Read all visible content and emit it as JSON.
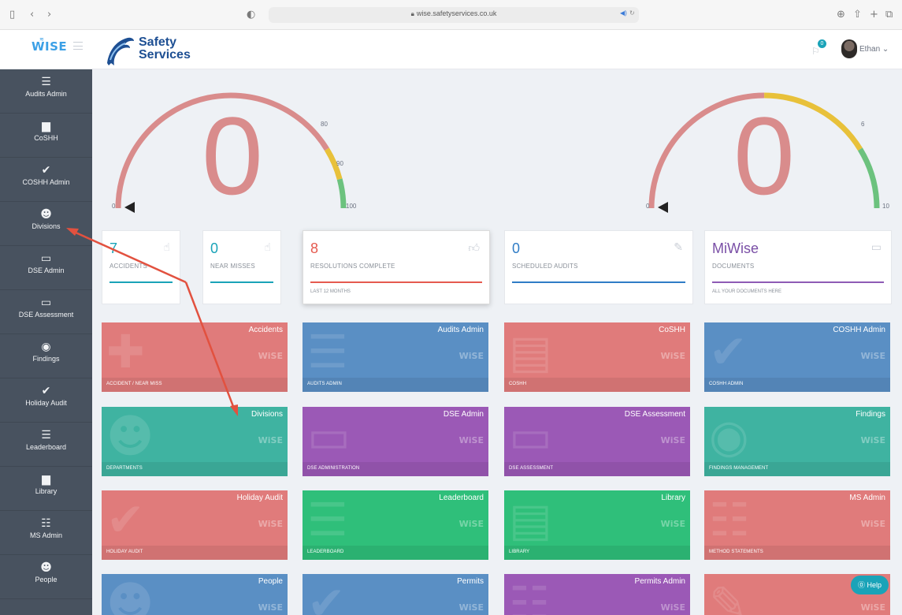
{
  "browser": {
    "url": "wise.safetyservices.co.uk",
    "icons": [
      "sidebar-icon",
      "back-icon",
      "forward-icon",
      "shield-icon",
      "download-icon",
      "share-icon",
      "new-tab-icon",
      "tabs-icon"
    ]
  },
  "header": {
    "app_logo": "WISE",
    "brand_line1": "Safety",
    "brand_line2": "Services",
    "notification_count": "0",
    "user_name": "Ethan ⌄"
  },
  "sidebar": {
    "items": [
      {
        "label": "Audits Admin",
        "icon": "list-icon"
      },
      {
        "label": "CoSHH",
        "icon": "book-icon"
      },
      {
        "label": "COSHH Admin",
        "icon": "check-icon"
      },
      {
        "label": "Divisions",
        "icon": "users-icon"
      },
      {
        "label": "DSE Admin",
        "icon": "monitor-icon"
      },
      {
        "label": "DSE Assessment",
        "icon": "monitor-icon"
      },
      {
        "label": "Findings",
        "icon": "eye-icon"
      },
      {
        "label": "Holiday Audit",
        "icon": "check-icon"
      },
      {
        "label": "Leaderboard",
        "icon": "list-icon"
      },
      {
        "label": "Library",
        "icon": "book-icon"
      },
      {
        "label": "MS Admin",
        "icon": "document-icon"
      },
      {
        "label": "People",
        "icon": "users-icon"
      }
    ]
  },
  "gauges": [
    {
      "value": "0",
      "value_number": 0,
      "ticks": [
        "0",
        "80",
        "90",
        "100"
      ],
      "segments": [
        {
          "color": "#d98c8c"
        },
        {
          "color": "#e8c13a"
        },
        {
          "color": "#6cc27e"
        }
      ]
    },
    {
      "value": "0",
      "value_number": 0,
      "ticks": [
        "0",
        "6",
        "10"
      ],
      "segments": [
        {
          "color": "#d98c8c"
        },
        {
          "color": "#e8c13a"
        },
        {
          "color": "#6cc27e"
        }
      ]
    }
  ],
  "stats": [
    {
      "value": "7",
      "label": "ACCIDENTS",
      "sub": "",
      "color": "#1aa3b8",
      "bar_color": "#1aa3b8",
      "icon": "hand-pointer-icon"
    },
    {
      "value": "0",
      "label": "NEAR MISSES",
      "sub": "",
      "color": "#1aa3b8",
      "bar_color": "#1aa3b8",
      "icon": "hand-pointer-icon"
    },
    {
      "value": "8",
      "label": "RESOLUTIONS COMPLETE",
      "sub": "LAST 12 MONTHS",
      "color": "#e55a4f",
      "bar_color": "#e55a4f",
      "icon": "thumbs-up-icon"
    },
    {
      "value": "0",
      "label": "SCHEDULED AUDITS",
      "sub": "",
      "color": "#2f7cc6",
      "bar_color": "#2f7cc6",
      "icon": "edit-icon"
    },
    {
      "value": "MiWise",
      "label": "DOCUMENTS",
      "sub": "ALL YOUR DOCUMENTS HERE",
      "color": "#7a4fa6",
      "bar_color": "#8e5bb5",
      "icon": "folder-icon"
    }
  ],
  "tiles": [
    {
      "title": "Accidents",
      "sub": "ACCIDENT / NEAR MISS",
      "color": "#e07b7b",
      "icon": "first-aid-icon"
    },
    {
      "title": "Audits Admin",
      "sub": "AUDITS ADMIN",
      "color": "#5a8fc4",
      "icon": "list-icon"
    },
    {
      "title": "CoSHH",
      "sub": "COSHH",
      "color": "#e07b7b",
      "icon": "book-icon"
    },
    {
      "title": "COSHH Admin",
      "sub": "COSHH ADMIN",
      "color": "#5a8fc4",
      "icon": "check-icon"
    },
    {
      "title": "Divisions",
      "sub": "DEPARTMENTS",
      "color": "#3fb3a1",
      "icon": "users-icon"
    },
    {
      "title": "DSE Admin",
      "sub": "DSE ADMINISTRATION",
      "color": "#9b59b6",
      "icon": "monitor-icon"
    },
    {
      "title": "DSE Assessment",
      "sub": "DSE ASSESSMENT",
      "color": "#9b59b6",
      "icon": "monitor-icon"
    },
    {
      "title": "Findings",
      "sub": "FINDINGS MANAGEMENT",
      "color": "#3fb3a1",
      "icon": "eye-icon"
    },
    {
      "title": "Holiday Audit",
      "sub": "HOLIDAY AUDIT",
      "color": "#e07b7b",
      "icon": "check-icon"
    },
    {
      "title": "Leaderboard",
      "sub": "LEADERBOARD",
      "color": "#2fbf7a",
      "icon": "list-icon"
    },
    {
      "title": "Library",
      "sub": "LIBRARY",
      "color": "#2fbf7a",
      "icon": "book-icon"
    },
    {
      "title": "MS Admin",
      "sub": "METHOD STATEMENTS",
      "color": "#e07b7b",
      "icon": "document-icon"
    },
    {
      "title": "People",
      "sub": "",
      "color": "#5a8fc4",
      "icon": "users-icon"
    },
    {
      "title": "Permits",
      "sub": "",
      "color": "#5a8fc4",
      "icon": "check-icon"
    },
    {
      "title": "Permits Admin",
      "sub": "",
      "color": "#9b59b6",
      "icon": "document-icon"
    },
    {
      "title": "",
      "sub": "",
      "color": "#e07b7b",
      "icon": "pencil-icon"
    }
  ],
  "tile_watermark": "WiSE",
  "help": {
    "label": "⓪ Help"
  },
  "annotation": {
    "color": "#e2513f"
  }
}
